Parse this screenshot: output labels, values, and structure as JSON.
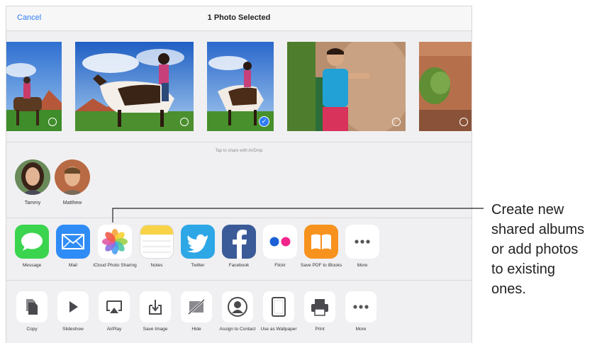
{
  "header": {
    "cancel_label": "Cancel",
    "title": "1 Photo Selected"
  },
  "photos": [
    {
      "name": "horse-rider-left",
      "selected": false
    },
    {
      "name": "horse-rider-woman",
      "selected": false
    },
    {
      "name": "horse-rider-selected",
      "selected": true
    },
    {
      "name": "man-at-rock",
      "selected": false
    },
    {
      "name": "desert-plant",
      "selected": false
    }
  ],
  "airdrop": {
    "hint": "Tap to share with AirDrop",
    "people": [
      {
        "name": "Tammy"
      },
      {
        "name": "Matthew"
      }
    ]
  },
  "share_apps": [
    {
      "label": "Message",
      "icon": "message-icon",
      "color": "#3bd44f"
    },
    {
      "label": "Mail",
      "icon": "mail-icon",
      "color": "#2f8cf6"
    },
    {
      "label": "iCloud Photo Sharing",
      "icon": "photos-pinwheel-icon",
      "color": "#ffffff"
    },
    {
      "label": "Notes",
      "icon": "notes-icon",
      "color": "#f8d348"
    },
    {
      "label": "Twitter",
      "icon": "twitter-bird-icon",
      "color": "#2da7e6"
    },
    {
      "label": "Facebook",
      "icon": "facebook-icon",
      "color": "#3b5a98"
    },
    {
      "label": "Flickr",
      "icon": "flickr-icon",
      "color": "#ffffff"
    },
    {
      "label": "Save PDF to iBooks",
      "icon": "ibooks-icon",
      "color": "#f7921e"
    },
    {
      "label": "More",
      "icon": "more-dots-icon",
      "color": "#ffffff"
    }
  ],
  "actions": [
    {
      "label": "Copy",
      "icon": "copy-icon"
    },
    {
      "label": "Slideshow",
      "icon": "play-icon"
    },
    {
      "label": "AirPlay",
      "icon": "airplay-icon"
    },
    {
      "label": "Save Image",
      "icon": "save-image-icon"
    },
    {
      "label": "Hide",
      "icon": "hide-icon"
    },
    {
      "label": "Assign to Contact",
      "icon": "contact-icon"
    },
    {
      "label": "Use as Wallpaper",
      "icon": "wallpaper-icon"
    },
    {
      "label": "Print",
      "icon": "print-icon"
    },
    {
      "label": "More",
      "icon": "more-dots-icon"
    }
  ],
  "callout": {
    "lines": [
      "Create new",
      "shared albums",
      "or add photos",
      "to existing",
      "ones."
    ]
  }
}
